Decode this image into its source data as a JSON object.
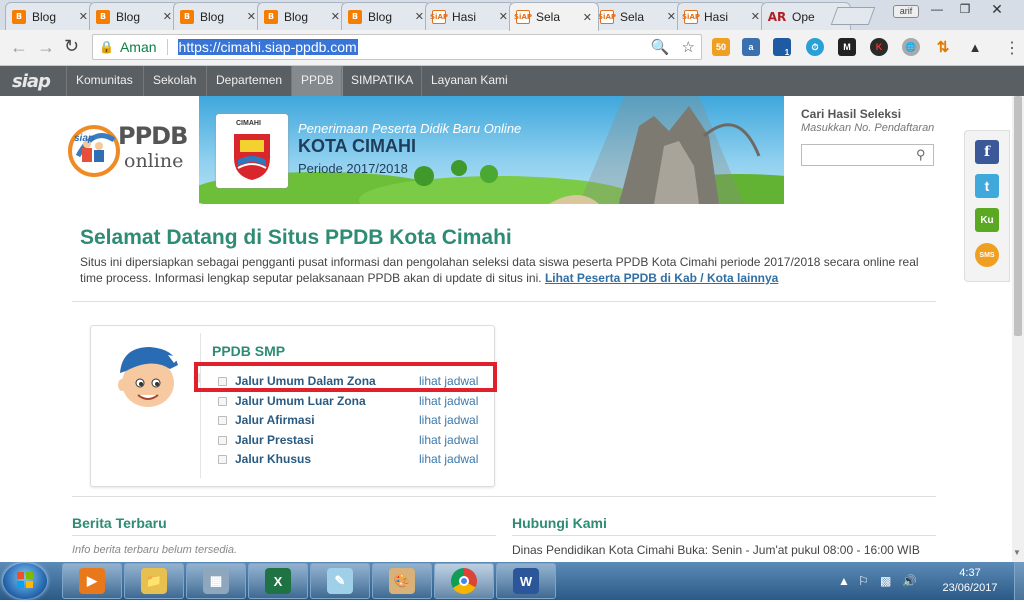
{
  "browser": {
    "tabs": [
      {
        "title": "Blog",
        "icon": "blogger-icon",
        "kind": "blog"
      },
      {
        "title": "Blog",
        "icon": "blogger-icon",
        "kind": "blog"
      },
      {
        "title": "Blog",
        "icon": "blogger-icon",
        "kind": "blog"
      },
      {
        "title": "Blog",
        "icon": "blogger-icon",
        "kind": "blog"
      },
      {
        "title": "Blog",
        "icon": "blogger-icon",
        "kind": "blog"
      },
      {
        "title": "Hasi",
        "icon": "siap-icon",
        "kind": "siap"
      },
      {
        "title": "Sela",
        "icon": "siap-icon",
        "kind": "siap"
      },
      {
        "title": "Sela",
        "icon": "siap-icon",
        "kind": "siap"
      },
      {
        "title": "Hasi",
        "icon": "siap-icon",
        "kind": "siap"
      },
      {
        "title": "Ope",
        "icon": "ar-icon",
        "kind": "ar"
      }
    ],
    "active_tab": 6,
    "user_badge": "arif",
    "secure_label": "Aman",
    "url": "https://cimahi.siap-ppdb.com",
    "extension_badge": "1"
  },
  "site": {
    "brand": "siap",
    "nav": [
      "Komunitas",
      "Sekolah",
      "Departemen",
      "PPDB",
      "SIMPATIKA",
      "Layanan Kami"
    ],
    "active_nav": "PPDB",
    "logo_main": "PPDB",
    "logo_sub": "online",
    "logo_badge": "siap",
    "banner": {
      "crest_label": "CIMAHI",
      "line1": "Penerimaan Peserta Didik Baru Online",
      "line2": "KOTA CIMAHI",
      "line3": "Periode 2017/2018"
    },
    "search": {
      "title": "Cari Hasil Seleksi",
      "hint": "Masukkan No. Pendaftaran",
      "value": ""
    },
    "social": [
      "facebook-icon",
      "twitter-icon",
      "kakaotalk-icon",
      "sms-icon"
    ],
    "social_labels": {
      "facebook": "f",
      "twitter": "t",
      "kakaotalk": "Ku",
      "sms": "SMS"
    }
  },
  "welcome": {
    "title": "Selamat Datang di Situs PPDB Kota Cimahi",
    "body": "Situs ini dipersiapkan sebagai pengganti pusat informasi dan pengolahan seleksi data siswa peserta PPDB Kota Cimahi periode 2017/2018 secara online real time process. Informasi lengkap seputar pelaksanaan PPDB akan di update di situs ini.",
    "link": "Lihat Peserta PPDB di Kab / Kota lainnya"
  },
  "card": {
    "heading": "PPDB SMP",
    "rows": [
      {
        "label": "Jalur Umum Dalam Zona",
        "link": "lihat jadwal"
      },
      {
        "label": "Jalur Umum Luar Zona",
        "link": "lihat jadwal"
      },
      {
        "label": "Jalur Afirmasi",
        "link": "lihat jadwal"
      },
      {
        "label": "Jalur Prestasi",
        "link": "lihat jadwal"
      },
      {
        "label": "Jalur Khusus",
        "link": "lihat jadwal"
      }
    ],
    "highlight_color": "#e0202a"
  },
  "news": {
    "heading": "Berita Terbaru",
    "empty": "Info berita terbaru belum tersedia."
  },
  "contact": {
    "heading": "Hubungi Kami",
    "text": "Dinas Pendidikan Kota Cimahi Buka: Senin - Jum'at pukul 08:00 - 16:00 WIB"
  },
  "taskbar": {
    "apps": [
      "media-player-icon",
      "file-explorer-icon",
      "calculator-icon",
      "excel-icon",
      "notepad-icon",
      "paint-icon",
      "chrome-icon",
      "word-icon"
    ],
    "app_glyphs": {
      "excel": "X",
      "word": "W"
    },
    "time": "4:37",
    "date": "23/06/2017"
  },
  "colors": {
    "accent": "#2e8b74",
    "link": "#2a5a80",
    "nav_bg": "#5a5f63"
  }
}
